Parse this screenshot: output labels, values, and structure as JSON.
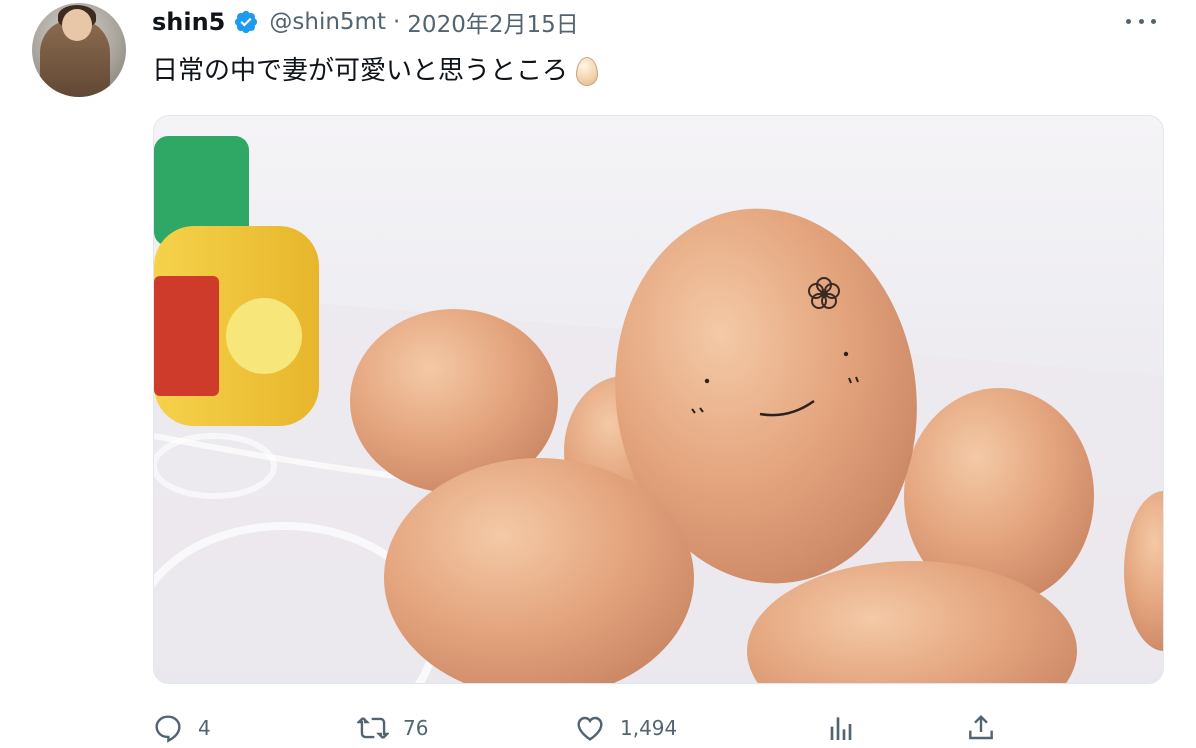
{
  "tweet": {
    "display_name": "shin5",
    "handle": "@shin5mt",
    "separator": "·",
    "date": "2020年2月15日",
    "text": "日常の中で妻が可愛いと思うところ",
    "emoji": "egg"
  },
  "actions": {
    "reply_count": "4",
    "retweet_count": "76",
    "like_count": "1,494"
  },
  "icons": {
    "verified": "verified-badge-icon",
    "more": "more-icon",
    "reply": "reply-icon",
    "retweet": "retweet-icon",
    "like": "heart-icon",
    "analytics": "analytics-icon",
    "share": "share-icon"
  },
  "colors": {
    "verified_blue": "#1d9bf0",
    "secondary_text": "#536471",
    "primary_text": "#0f1419"
  }
}
